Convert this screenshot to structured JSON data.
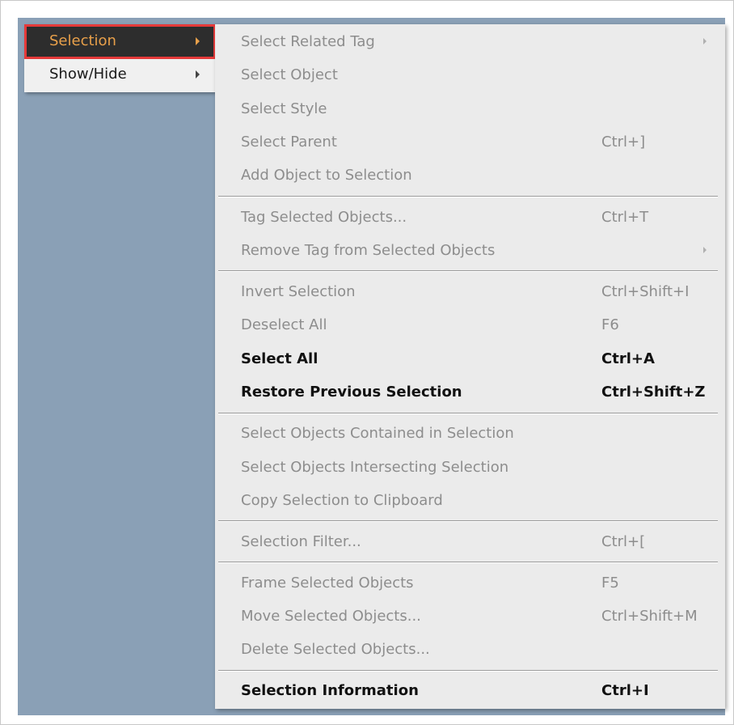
{
  "parent_menu": {
    "items": [
      {
        "label": "Selection",
        "active": true
      },
      {
        "label": "Show/Hide",
        "active": false
      }
    ]
  },
  "submenu": {
    "items": [
      {
        "label": "Select Related Tag",
        "shortcut": "",
        "enabled": false
      },
      {
        "label": "Select Object",
        "shortcut": "",
        "enabled": false
      },
      {
        "label": "Select Style",
        "shortcut": "",
        "enabled": false
      },
      {
        "label": "Select Parent",
        "shortcut": "Ctrl+]",
        "enabled": false
      },
      {
        "label": "Add Object to Selection",
        "shortcut": "",
        "enabled": false
      },
      {
        "label": "Tag Selected Objects...",
        "shortcut": "Ctrl+T",
        "enabled": false
      },
      {
        "label": "Remove Tag from Selected Objects",
        "shortcut": "",
        "enabled": false
      },
      {
        "label": "Invert Selection",
        "shortcut": "Ctrl+Shift+I",
        "enabled": false
      },
      {
        "label": "Deselect All",
        "shortcut": "F6",
        "enabled": false
      },
      {
        "label": "Select All",
        "shortcut": "Ctrl+A",
        "enabled": true
      },
      {
        "label": "Restore Previous Selection",
        "shortcut": "Ctrl+Shift+Z",
        "enabled": true
      },
      {
        "label": "Select Objects Contained in Selection",
        "shortcut": "",
        "enabled": false
      },
      {
        "label": "Select Objects Intersecting Selection",
        "shortcut": "",
        "enabled": false
      },
      {
        "label": "Copy Selection to Clipboard",
        "shortcut": "",
        "enabled": false
      },
      {
        "label": "Selection Filter...",
        "shortcut": "Ctrl+[",
        "enabled": false
      },
      {
        "label": "Frame Selected Objects",
        "shortcut": "F5",
        "enabled": false
      },
      {
        "label": "Move Selected Objects...",
        "shortcut": "Ctrl+Shift+M",
        "enabled": false
      },
      {
        "label": "Delete Selected Objects...",
        "shortcut": "",
        "enabled": false
      },
      {
        "label": "Selection Information",
        "shortcut": "Ctrl+I",
        "enabled": true
      }
    ]
  },
  "colors": {
    "menu_background": "#ebebeb",
    "desktop_background": "#8aa0b6",
    "active_item_background": "#2d2d2d",
    "active_item_text": "#e8a04a",
    "highlight_border": "#e53a3a",
    "disabled_text": "#8d8d8d",
    "enabled_text": "#111111"
  }
}
